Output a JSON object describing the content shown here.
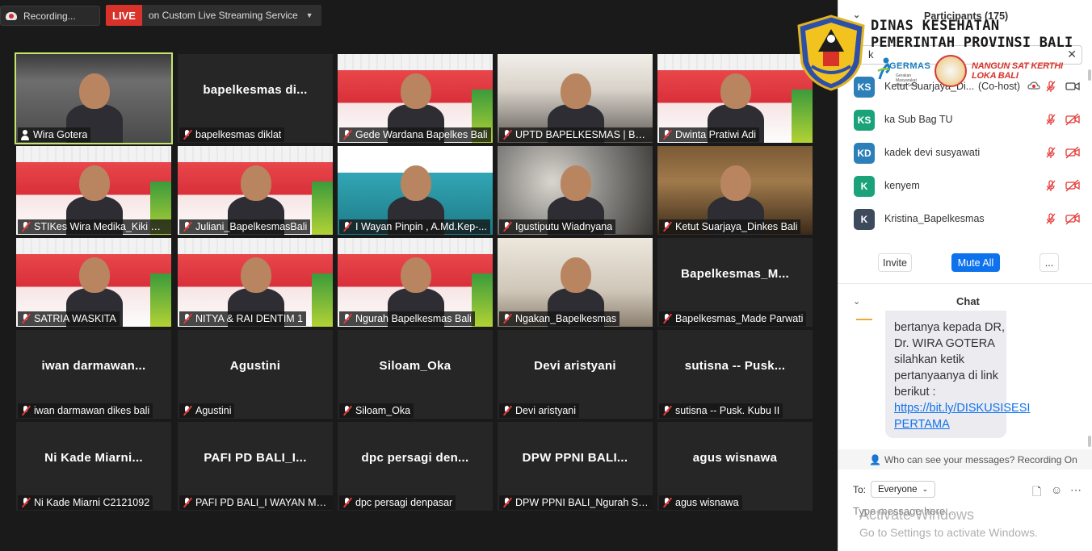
{
  "topbar": {
    "recording_label": "Recording...",
    "live_badge": "LIVE",
    "stream_service": "on Custom Live Streaming Service"
  },
  "tiles": [
    {
      "big": "",
      "name": "Wira Gotera",
      "video": "v-room",
      "active": true,
      "muted": false
    },
    {
      "big": "bapelkesmas  di...",
      "name": "bapelkesmas diklat",
      "video": "",
      "muted": true
    },
    {
      "big": "",
      "name": "Gede Wardana Bapelkes Bali",
      "video": "v-banner",
      "muted": true
    },
    {
      "big": "",
      "name": "UPTD BAPELKESMAS | BALI",
      "video": "v-classroom",
      "muted": true
    },
    {
      "big": "",
      "name": "Dwinta Pratiwi Adi",
      "video": "v-banner",
      "muted": true
    },
    {
      "big": "",
      "name": "STIKes Wira Medika_Kiki Ri...",
      "video": "v-banner",
      "muted": true
    },
    {
      "big": "",
      "name": "Juliani_BapelkesmasBali",
      "video": "v-banner",
      "muted": true
    },
    {
      "big": "",
      "name": "I Wayan Pinpin , A.Md.Kep-...",
      "video": "v-slide",
      "muted": true
    },
    {
      "big": "",
      "name": "Igustiputu Wiadnyana",
      "video": "v-emblem",
      "muted": true
    },
    {
      "big": "",
      "name": "Ketut Suarjaya_Dinkes Bali",
      "video": "v-hall",
      "muted": true
    },
    {
      "big": "",
      "name": "SATRIA WASKITA",
      "video": "v-banner",
      "muted": true
    },
    {
      "big": "",
      "name": "NITYA & RAI DENTIM 1",
      "video": "v-banner",
      "muted": true
    },
    {
      "big": "",
      "name": "Ngurah Bapelkesmas Bali",
      "video": "v-banner",
      "muted": true
    },
    {
      "big": "",
      "name": "Ngakan_Bapelkesmas",
      "video": "v-office",
      "muted": true
    },
    {
      "big": "Bapelkesmas_M...",
      "name": "Bapelkesmas_Made Parwati",
      "video": "",
      "muted": true
    },
    {
      "big": "iwan  darmawan...",
      "name": "iwan darmawan dikes bali",
      "video": "",
      "muted": true
    },
    {
      "big": "Agustini",
      "name": "Agustini",
      "video": "",
      "muted": true
    },
    {
      "big": "Siloam_Oka",
      "name": "Siloam_Oka",
      "video": "",
      "muted": true
    },
    {
      "big": "Devi aristyani",
      "name": "Devi aristyani",
      "video": "",
      "muted": true
    },
    {
      "big": "sutisna  --  Pusk...",
      "name": "sutisna  --  Pusk. Kubu II",
      "video": "",
      "muted": true
    },
    {
      "big": "Ni  Kade  Miarni...",
      "name": "Ni Kade Miarni C2121092",
      "video": "",
      "muted": true
    },
    {
      "big": "PAFI PD BALI_I...",
      "name": "PAFI PD BALI_I WAYAN MUDA",
      "video": "",
      "muted": true
    },
    {
      "big": "dpc  persagi  den...",
      "name": "dpc persagi denpasar",
      "video": "",
      "muted": true
    },
    {
      "big": "DPW PPNI BALI...",
      "name": "DPW PPNI BALI_Ngurah Su...",
      "video": "",
      "muted": true
    },
    {
      "big": "agus wisnawa",
      "name": "agus wisnawa",
      "video": "",
      "muted": true
    }
  ],
  "panel": {
    "participants_title": "Participants (175)",
    "search_value": "k",
    "logo_line1": "DINAS KESEHATAN",
    "logo_line2": "PEMERINTAH PROVINSI BALI",
    "germas": "GERMAS",
    "germas_sub": "Gerakan Masyarakat Hidup Sehat",
    "sat_kerthi": "NANGUN SAT KERTHI LOKA BALI",
    "participants": [
      {
        "initials": "KS",
        "name": "Ketut Suarjaya_Di...",
        "role": "(Co-host)",
        "color": "#2c7fb8",
        "video_on": true
      },
      {
        "initials": "KS",
        "name": "ka Sub Bag TU",
        "role": "",
        "color": "#1aa37a",
        "video_on": false
      },
      {
        "initials": "KD",
        "name": "kadek devi susyawati",
        "role": "",
        "color": "#2c7fb8",
        "video_on": false
      },
      {
        "initials": "K",
        "name": "kenyem",
        "role": "",
        "color": "#1aa37a",
        "video_on": false
      },
      {
        "initials": "K",
        "name": "Kristina_Bapelkesmas",
        "role": "",
        "color": "#3d4a5c",
        "video_on": false
      }
    ],
    "invite": "Invite",
    "mute_all": "Mute All",
    "more": "...",
    "chat_title": "Chat",
    "chat_message_lines": [
      "bertanya kepada DR,",
      "Dr. WIRA GOTERA",
      "silahkan ketik",
      "pertanyaanya di link",
      "berikut :"
    ],
    "chat_link": "https://bit.ly/DISKUSISESIPERTAMA",
    "who_can_see": "Who can see your messages? Recording On",
    "to_label": "To:",
    "to_value": "Everyone",
    "type_placeholder": "Type message here...",
    "watermark_title": "Activate Windows",
    "watermark_sub": "Go to Settings to activate Windows."
  }
}
